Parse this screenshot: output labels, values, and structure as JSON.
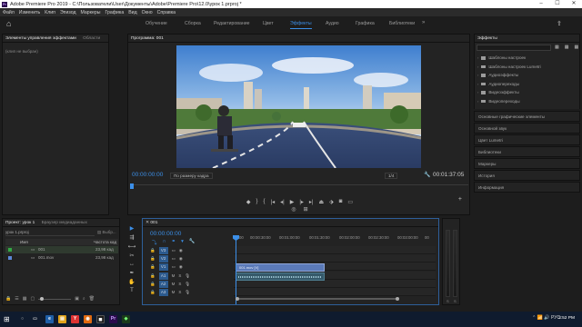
{
  "window": {
    "title": "Adobe Premiere Pro 2019 - C:\\Пользователи\\User\\Документы\\Adobe\\Premiere Pro\\12.0\\урок 1.prproj *",
    "app_icon": "Pr"
  },
  "menu": [
    "Файл",
    "Изменить",
    "Клип",
    "Эпизод",
    "Маркеры",
    "Графика",
    "Вид",
    "Окно",
    "Справка"
  ],
  "workspaces": {
    "tabs": [
      "Обучение",
      "Сборка",
      "Редактирование",
      "Цвет",
      "Эффекты",
      "Аудио",
      "Графика",
      "Библиотеки"
    ],
    "active": "Эффекты",
    "more_label": "»"
  },
  "effect_controls": {
    "tabs": [
      "Элементы управления эффектами",
      "Области "
    ],
    "empty_text": "(клип не выбран)"
  },
  "program_monitor": {
    "title": "Программа: 001",
    "timecode_left": "00:00:00:00",
    "fit": "По размеру кадра",
    "fraction": "1/4",
    "timecode_right": "00:01:37:05",
    "accent": "#3c8fe8"
  },
  "effects_panel": {
    "title": "Эффекты",
    "items": [
      "Шаблоны настроек",
      "Шаблоны настроек Lumetri",
      "Аудиоэффекты",
      "Аудиопереходы",
      "Видеоэффекты",
      "Видеопереходы"
    ]
  },
  "side_panels": [
    "Основные графические элементы",
    "Основной звук",
    "Цвет Lumetri",
    "Библиотеки",
    "Маркеры",
    "История",
    "Информация"
  ],
  "project_panel": {
    "tabs": [
      "Проект: урок 1",
      "Браузер медиаданных"
    ],
    "file": "урок 1.prproj",
    "filter_label": "Выбр...",
    "columns": [
      "Имя",
      "Частота кад"
    ],
    "rows": [
      {
        "name": "001",
        "rate": "23,98 кад",
        "color": "#33a845"
      },
      {
        "name": "001.mov",
        "rate": "23,98 кад",
        "color": "#5c88d8"
      }
    ]
  },
  "timeline": {
    "sequence": "001",
    "timecode": "00:00:00:00",
    "ruler": [
      "00:00",
      "00:00:30:00",
      "00:01:00:00",
      "00:01:30:00",
      "00:02:00:00",
      "00:02:30:00",
      "00:03:00:00",
      "00"
    ],
    "video_tracks": [
      "V3",
      "V2",
      "V1"
    ],
    "audio_tracks": [
      "A1",
      "A2",
      "A3"
    ],
    "video_clip_label": "001.mov [V]",
    "clip_video_color": "#5b7ab8",
    "clip_audio_color": "#35596a"
  },
  "meter": {
    "labels": [
      "S",
      "S"
    ]
  },
  "taskbar": {
    "lang": "РУС",
    "time": "3:52 PM"
  }
}
